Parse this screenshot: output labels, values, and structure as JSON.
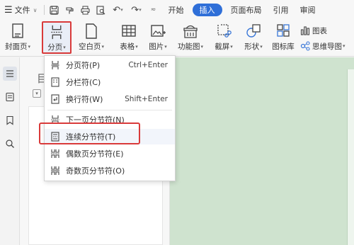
{
  "menubar": {
    "file_label": "文件",
    "tabs": [
      {
        "label": "开始"
      },
      {
        "label": "插入"
      },
      {
        "label": "页面布局"
      },
      {
        "label": "引用"
      },
      {
        "label": "审阅"
      }
    ]
  },
  "ribbon": {
    "cover_page": "封面页",
    "page_break": "分页",
    "blank_page": "空白页",
    "table": "表格",
    "picture": "图片",
    "function_chart": "功能图",
    "screenshot": "截屏",
    "shapes": "形状",
    "icon_library": "图标库",
    "chart": "图表",
    "mind_map": "思维导图"
  },
  "panel": {
    "heading_glyph": "目"
  },
  "dropdown": {
    "items": [
      {
        "label": "分页符(P)",
        "shortcut": "Ctrl+Enter"
      },
      {
        "label": "分栏符(C)",
        "shortcut": ""
      },
      {
        "label": "换行符(W)",
        "shortcut": "Shift+Enter"
      },
      {
        "label": "下一页分节符(N)",
        "shortcut": ""
      },
      {
        "label": "连续分节符(T)",
        "shortcut": ""
      },
      {
        "label": "偶数页分节符(E)",
        "shortcut": ""
      },
      {
        "label": "奇数页分节符(O)",
        "shortcut": ""
      }
    ]
  },
  "colors": {
    "accent": "#2f6fd8",
    "highlight_border": "#d93a3a",
    "doc_background": "#cfe3cf"
  }
}
